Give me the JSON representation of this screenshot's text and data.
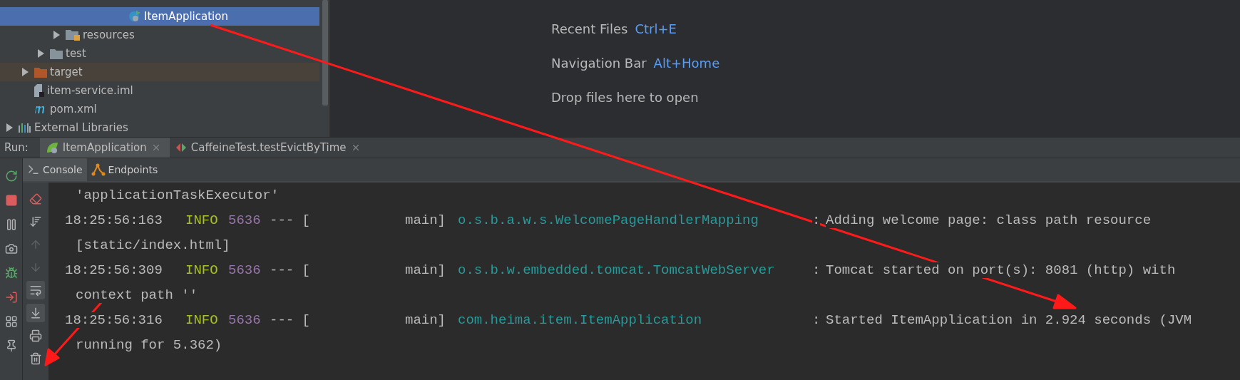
{
  "project_tree": [
    {
      "children": [
        {
          "children": [
            {
              "children": [
                {
                  "children": [
                    {
                      "children": [
                        {
                          "children": [
                            {
                              "children": [
                                {
                                  "label": "ItemApplication",
                                  "kind": "class",
                                  "selected": true
                                }
                              ]
                            }
                          ]
                        }
                      ]
                    }
                  ]
                },
                {
                  "label": "resources",
                  "kind": "resources-folder",
                  "expanded": false,
                  "selected": false
                }
              ]
            },
            {
              "label": "test",
              "kind": "folder",
              "expanded": false,
              "selected": false,
              "excluded": false
            }
          ]
        },
        {
          "label": "target",
          "kind": "folder",
          "expanded": false,
          "selected": false,
          "excluded": true
        },
        {
          "label": "item-service.iml",
          "kind": "file",
          "selected": false
        },
        {
          "label": "pom.xml",
          "kind": "maven",
          "selected": false
        }
      ]
    },
    {
      "label": "External Libraries",
      "kind": "libraries",
      "expanded": false,
      "selected": false
    }
  ],
  "editor_hints": [
    {
      "label": "Recent Files",
      "shortcut": "Ctrl+E"
    },
    {
      "label": "Navigation Bar",
      "shortcut": "Alt+Home"
    }
  ],
  "drop_hint": "Drop files here to open",
  "run_panel": {
    "title": "Run:",
    "tabs": [
      {
        "label": "ItemApplication",
        "kind": "spring",
        "selected": true
      },
      {
        "label": "CaffeineTest.testEvictByTime",
        "kind": "test",
        "selected": false
      }
    ],
    "subtabs": [
      {
        "label": "Console",
        "kind": "console",
        "selected": true
      },
      {
        "label": "Endpoints",
        "kind": "endpoints",
        "selected": false
      }
    ],
    "side_tools": [
      {
        "kind": "rerun"
      },
      {
        "kind": "stop"
      },
      {
        "kind": "pause"
      },
      {
        "kind": "camera"
      },
      {
        "kind": "debug"
      },
      {
        "kind": "exit"
      },
      {
        "kind": "layout"
      },
      {
        "kind": "pin"
      }
    ],
    "console_tools": [
      {
        "kind": "clear",
        "on": false,
        "disabled": false
      },
      {
        "kind": "sort",
        "on": false,
        "disabled": false
      },
      {
        "kind": "up",
        "on": false,
        "disabled": true
      },
      {
        "kind": "down",
        "on": false,
        "disabled": true
      },
      {
        "kind": "wrap",
        "on": true,
        "disabled": false
      },
      {
        "kind": "scroll-end",
        "on": true,
        "disabled": false
      },
      {
        "kind": "print",
        "on": false,
        "disabled": false
      },
      {
        "kind": "trash",
        "on": false,
        "disabled": false
      }
    ],
    "console_lines": [
      {
        "kind": "continuation",
        "text": "'applicationTaskExecutor'"
      },
      {
        "kind": "log",
        "time": "18:25:56:163",
        "level": "INFO",
        "pid": "5636",
        "separator": "--- [",
        "thread": "main]",
        "logger": "o.s.b.a.w.s.WelcomePageHandlerMapping",
        "colon": ":",
        "message": "Adding welcome page: class path resource"
      },
      {
        "kind": "continuation",
        "text": "[static/index.html]"
      },
      {
        "kind": "log",
        "time": "18:25:56:309",
        "level": "INFO",
        "pid": "5636",
        "separator": "--- [",
        "thread": "main]",
        "logger": "o.s.b.w.embedded.tomcat.TomcatWebServer",
        "colon": ":",
        "message": "Tomcat started on port(s): 8081 (http) with"
      },
      {
        "kind": "continuation",
        "text": "context path ''"
      },
      {
        "kind": "log",
        "time": "18:25:56:316",
        "level": "INFO",
        "pid": "5636",
        "separator": "--- [",
        "thread": "main]",
        "logger": "com.heima.item.ItemApplication",
        "colon": ":",
        "message": "Started ItemApplication in 2.924 seconds (JVM"
      },
      {
        "kind": "continuation",
        "text": "running for 5.362)"
      }
    ]
  }
}
